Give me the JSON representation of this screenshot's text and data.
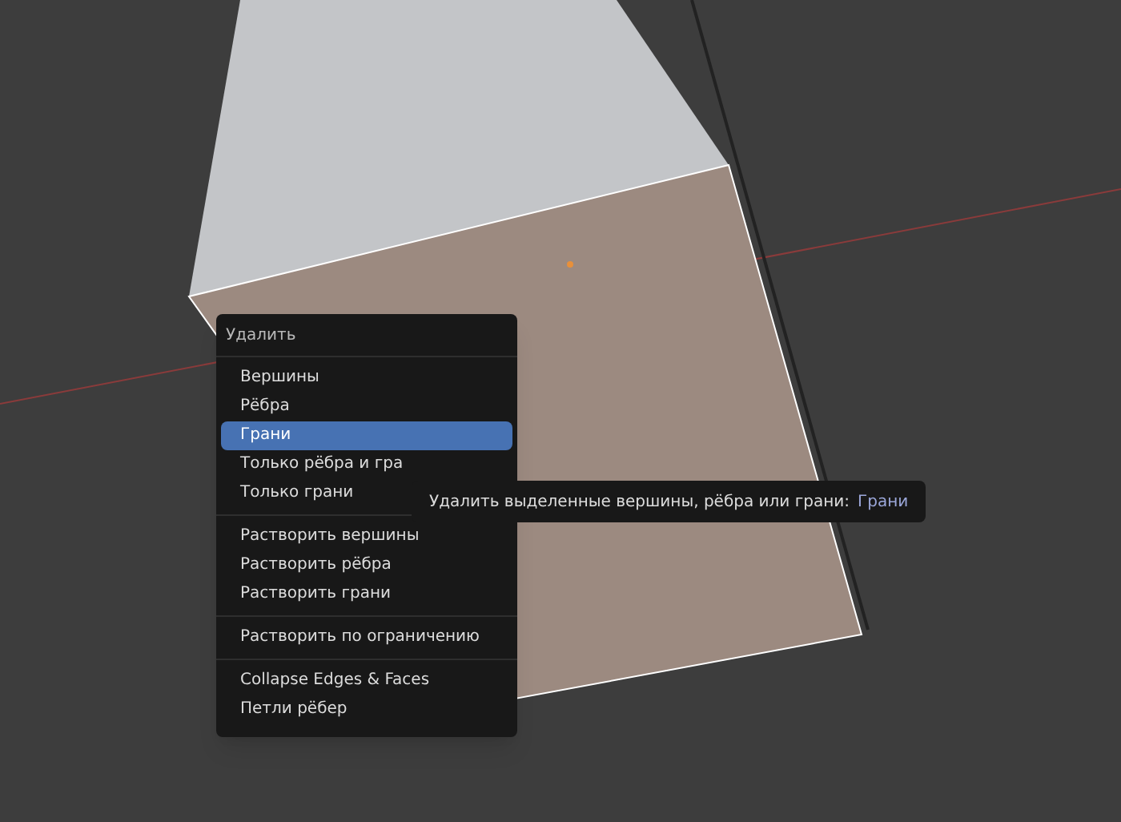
{
  "menu": {
    "title": "Удалить",
    "sections": [
      {
        "items": [
          {
            "label": "Вершины",
            "selected": false
          },
          {
            "label": "Рёбра",
            "selected": false
          },
          {
            "label": "Грани",
            "selected": true
          },
          {
            "label": "Только рёбра и гра",
            "selected": false
          },
          {
            "label": "Только грани",
            "selected": false
          }
        ]
      },
      {
        "items": [
          {
            "label": "Растворить вершины",
            "selected": false
          },
          {
            "label": "Растворить рёбра",
            "selected": false
          },
          {
            "label": "Растворить грани",
            "selected": false
          }
        ]
      },
      {
        "items": [
          {
            "label": "Растворить по ограничению",
            "selected": false
          }
        ]
      },
      {
        "items": [
          {
            "label": "Collapse Edges & Faces",
            "selected": false
          },
          {
            "label": "Петли рёбер",
            "selected": false
          }
        ]
      }
    ]
  },
  "tooltip": {
    "text": "Удалить выделенные вершины, рёбра или грани:",
    "value": "Грани"
  }
}
